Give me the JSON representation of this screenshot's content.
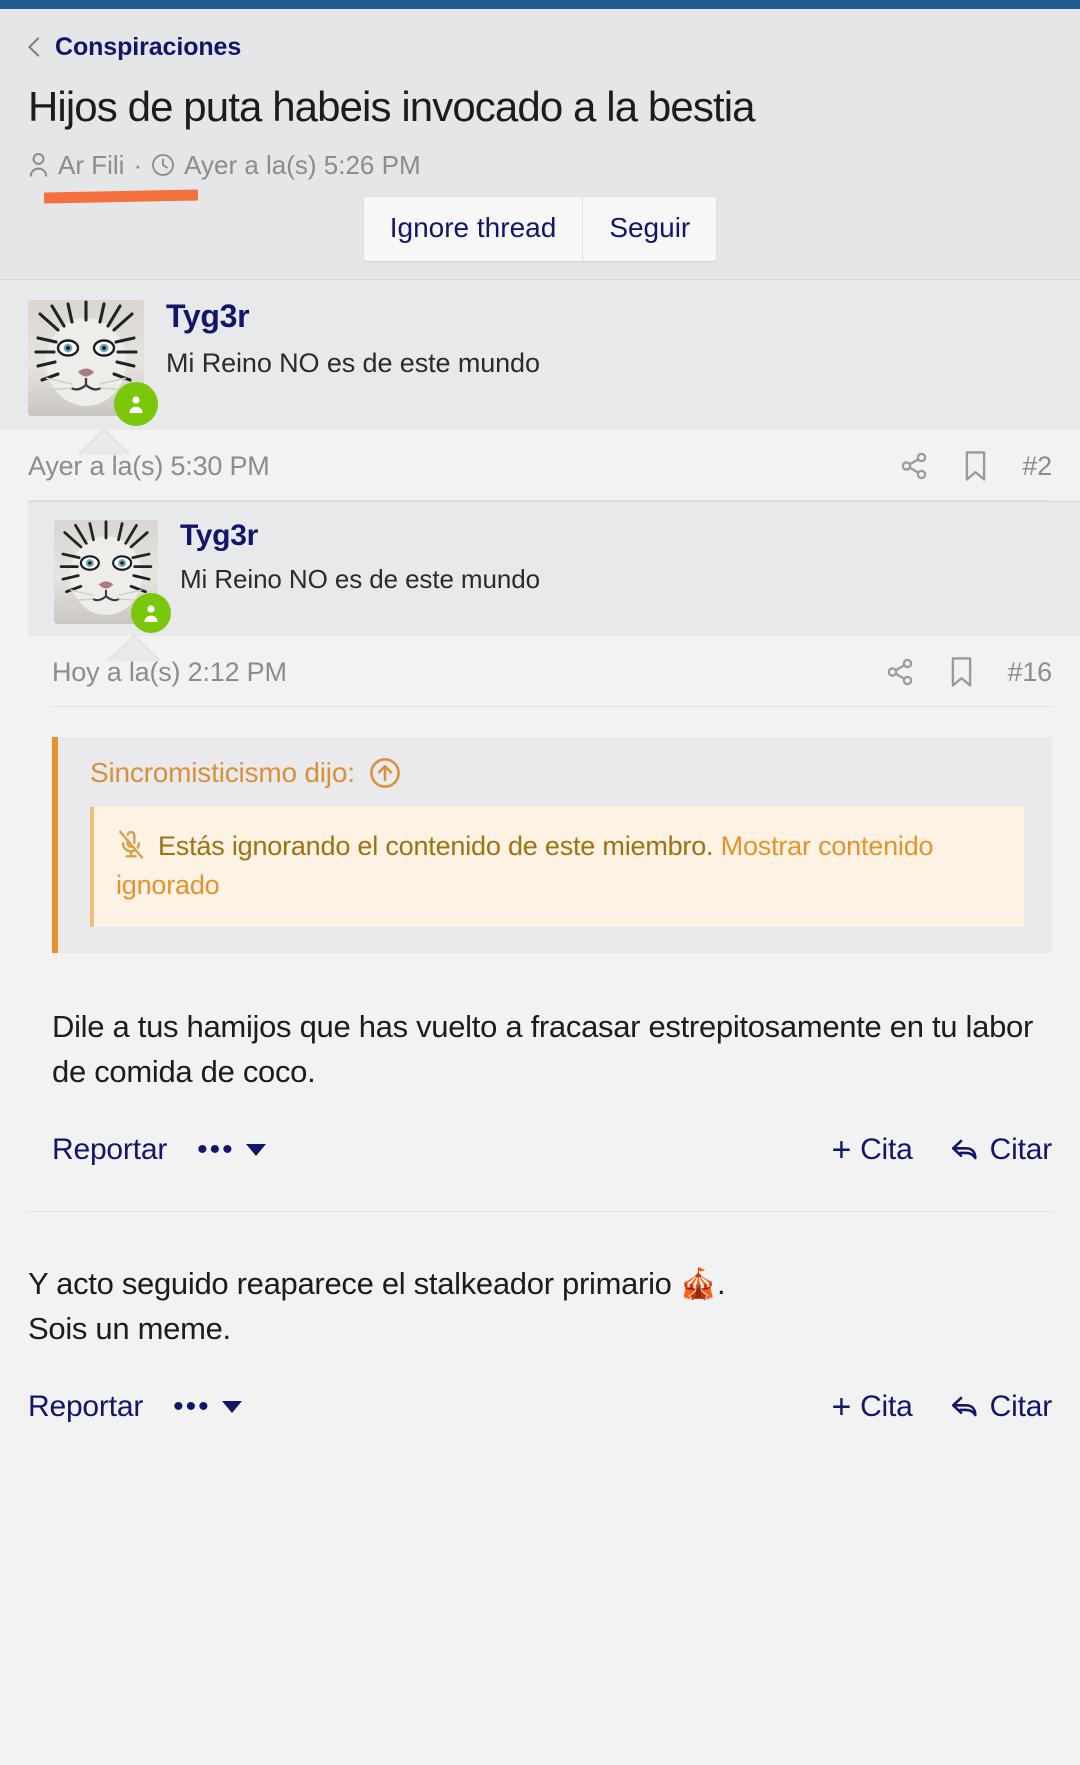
{
  "window": {
    "statusbar_color": "#1d5c8f"
  },
  "header": {
    "back_icon": "chevron-left-icon",
    "breadcrumb": "Conspiraciones",
    "title": "Hijos de puta habeis invocado a la bestia",
    "author_icon": "user-icon",
    "author": "Ar Fili",
    "separator": "·",
    "time_icon": "clock-icon",
    "time": "Ayer a la(s) 5:26 PM",
    "buttons": [
      {
        "label": "Ignore thread",
        "name": "ignore-thread-button"
      },
      {
        "label": "Seguir",
        "name": "follow-button"
      }
    ],
    "annotation_color": "#f4703c"
  },
  "posts": [
    {
      "user": {
        "name": "Tyg3r",
        "title": "Mi Reino NO es de este mundo",
        "avatar_icon": "white-tiger-avatar",
        "status_icon": "online-badge-icon",
        "status_color": "#7ac70c"
      },
      "date": "Ayer a la(s) 5:30 PM",
      "post_number": "#2",
      "share_icon": "share-icon",
      "bookmark_icon": "bookmark-icon"
    },
    {
      "user": {
        "name": "Tyg3r",
        "title": "Mi Reino NO es de este mundo",
        "avatar_icon": "white-tiger-avatar",
        "status_icon": "online-badge-icon",
        "status_color": "#7ac70c"
      },
      "date": "Hoy a la(s) 2:12 PM",
      "post_number": "#16",
      "share_icon": "share-icon",
      "bookmark_icon": "bookmark-icon",
      "quote": {
        "header": "Sincromisticismo dijo:",
        "jump_icon": "arrow-up-circle-icon",
        "accent_color": "#e8922c",
        "ignored": {
          "icon": "mic-off-icon",
          "text": "Estás ignorando el contenido de este miembro.",
          "link": "Mostrar contenido ignorado"
        }
      },
      "body": "Dile a tus hamijos que has vuelto a fracasar estrepitosamente en tu labor de comida de coco.",
      "actions": {
        "report": "Reportar",
        "more_icon": "more-dots-icon",
        "caret_icon": "caret-down-icon",
        "quote_add": "Cita",
        "quote_add_icon": "plus-icon",
        "quote_reply": "Citar",
        "quote_reply_icon": "reply-arrow-icon"
      }
    },
    {
      "body_prefix": "Y acto seguido reaparece el stalkeador primario ",
      "body_emoji": "🎪",
      "body_suffix": ".",
      "body_line2": "Sois un meme.",
      "actions": {
        "report": "Reportar",
        "more_icon": "more-dots-icon",
        "caret_icon": "caret-down-icon",
        "quote_add": "Cita",
        "quote_add_icon": "plus-icon",
        "quote_reply": "Citar",
        "quote_reply_icon": "reply-arrow-icon"
      }
    }
  ]
}
